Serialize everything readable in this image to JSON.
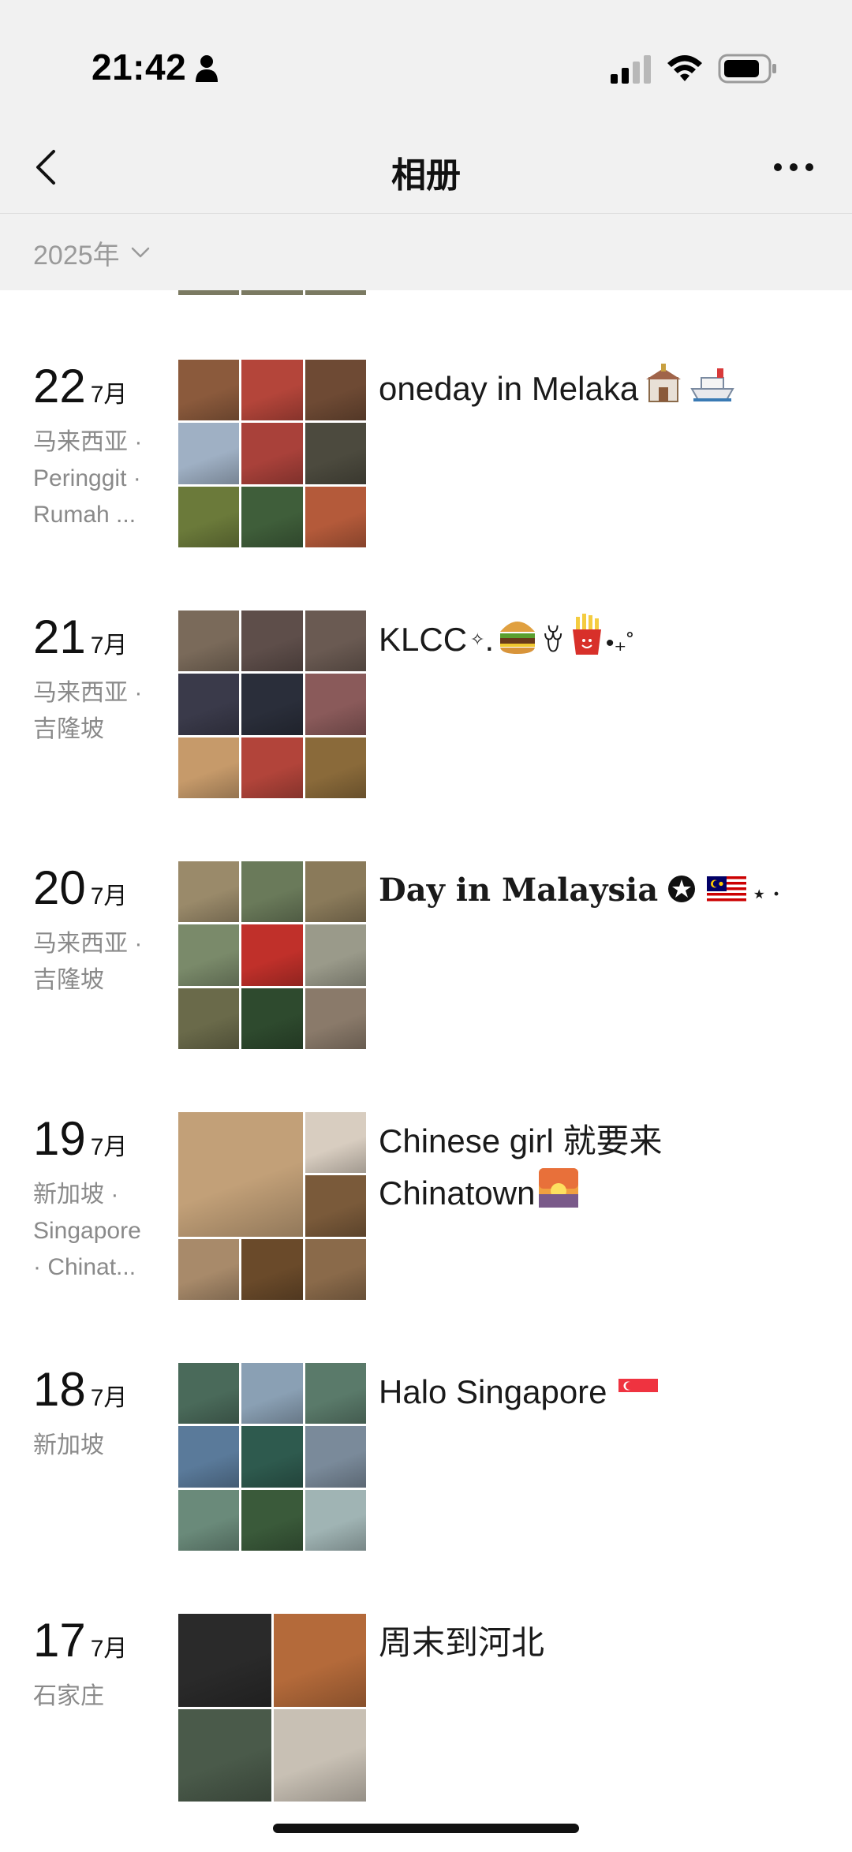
{
  "status_bar": {
    "time": "21:42"
  },
  "nav": {
    "title": "相册"
  },
  "filter": {
    "year": "2025年"
  },
  "entries": [
    {
      "day": "22",
      "month": "7月",
      "location": "马来西亚 ·\nPeringgit ·\n Rumah ...",
      "caption": "oneday in Melaka",
      "photo_colors": [
        "#8b5a3c",
        "#b4453a",
        "#6e4a34",
        "#9fb0c4",
        "#a9413a",
        "#4c4a3e",
        "#6b7a3a",
        "#3f5e3a",
        "#b45a3a"
      ]
    },
    {
      "day": "21",
      "month": "7月",
      "location": "马来西亚 ·\n吉隆坡",
      "caption": "KLCC",
      "photo_colors": [
        "#7a6a5a",
        "#5e4e4a",
        "#6a5a52",
        "#3a3a4a",
        "#2a2e3a",
        "#8a5a5a",
        "#c69a6a",
        "#b2443a",
        "#8a6a3a"
      ]
    },
    {
      "day": "20",
      "month": "7月",
      "location": "马来西亚 ·\n吉隆坡",
      "caption": "Day in Malaysia",
      "photo_colors": [
        "#9a8a6a",
        "#6a7a5a",
        "#8a7a5a",
        "#7a8a6a",
        "#c0302a",
        "#9a9a8a",
        "#6a6a4a",
        "#2e4a2e",
        "#8a7a6a"
      ]
    },
    {
      "day": "19",
      "month": "7月",
      "location": "新加坡 ·\nSingapore\n· Chinat...",
      "caption": "Chinese girl 就要来 Chinatown",
      "photo_colors": [
        "#c2a078",
        "#d8cdc0",
        "#7a5a3a",
        "#a88a6a",
        "#6a4a2a",
        "#8a6a4a"
      ]
    },
    {
      "day": "18",
      "month": "7月",
      "location": "新加坡",
      "caption": "Halo Singapore",
      "photo_colors": [
        "#4a6a5a",
        "#8aa0b4",
        "#5a7a6a",
        "#5a7a9a",
        "#2e5a4e",
        "#7a8a9a",
        "#6a8a7a",
        "#3a5a3a",
        "#a0b4b4"
      ]
    },
    {
      "day": "17",
      "month": "7月",
      "location": "石家庄",
      "caption": "周末到河北",
      "photo_colors": [
        "#2a2a2a",
        "#b46a3a",
        "#4a5a4a",
        "#c8c0b4"
      ]
    }
  ]
}
